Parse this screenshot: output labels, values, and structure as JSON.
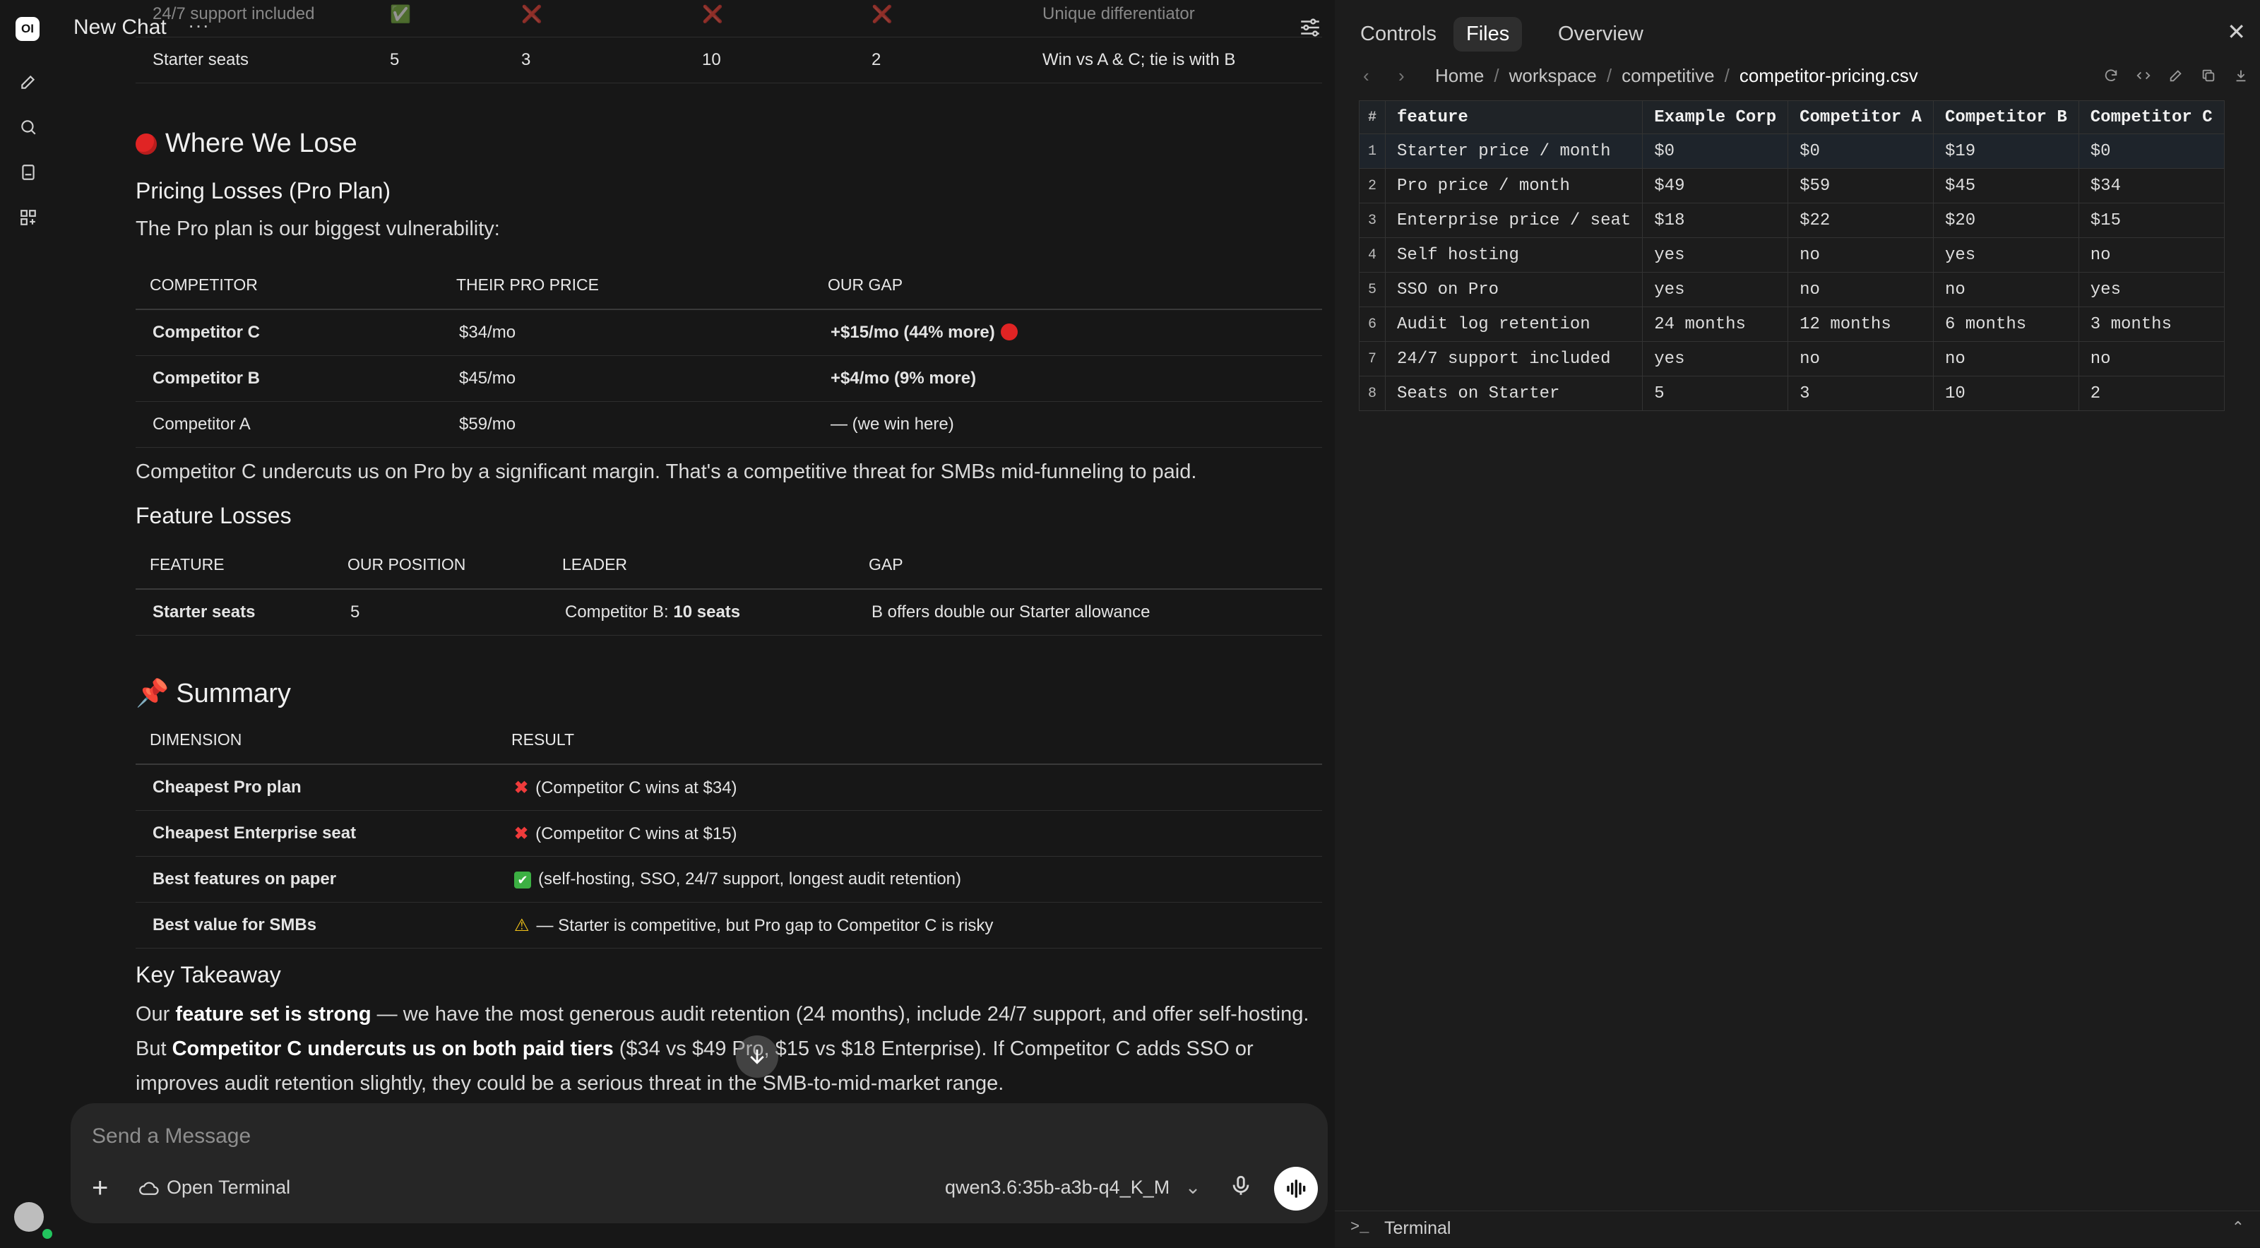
{
  "app": {
    "logo": "OI"
  },
  "chat": {
    "title": "New Chat",
    "more": "···",
    "top_table": {
      "rows": [
        {
          "feature": "24/7 support included",
          "a": "✅",
          "b": "❌",
          "c": "❌",
          "d": "❌",
          "note": "Unique differentiator"
        },
        {
          "feature": "Starter seats",
          "a": "5",
          "b": "3",
          "c": "10",
          "d": "2",
          "note": "Win vs A & C; tie is with B"
        }
      ]
    },
    "where_we_lose": {
      "heading": "Where We Lose",
      "pricing_heading": "Pricing Losses (Pro Plan)",
      "intro": "The Pro plan is our biggest vulnerability:",
      "pricing_table": {
        "headers": [
          "Competitor",
          "Their Pro Price",
          "Our Gap"
        ],
        "rows": [
          {
            "competitor": "Competitor C",
            "price": "$34/mo",
            "gap": "+$15/mo (44% more)"
          },
          {
            "competitor": "Competitor B",
            "price": "$45/mo",
            "gap": "+$4/mo (9% more)"
          },
          {
            "competitor": "Competitor A",
            "price": "$59/mo",
            "gap": "— (we win here)"
          }
        ]
      },
      "pricing_note": "Competitor C undercuts us on Pro by a significant margin. That's a competitive threat for SMBs mid-funneling to paid.",
      "feature_heading": "Feature Losses",
      "feature_table": {
        "headers": [
          "Feature",
          "Our Position",
          "Leader",
          "Gap"
        ],
        "rows": [
          {
            "feature": "Starter seats",
            "position": "5",
            "leader_prefix": "Competitor B: ",
            "leader_bold": "10 seats",
            "gap": "B offers double our Starter allowance"
          }
        ]
      }
    },
    "summary": {
      "heading": "Summary",
      "headers": [
        "Dimension",
        "Result"
      ],
      "rows": [
        {
          "dimension": "Cheapest Pro plan",
          "result": "(Competitor C wins at $34)"
        },
        {
          "dimension": "Cheapest Enterprise seat",
          "result": "(Competitor C wins at $15)"
        },
        {
          "dimension": "Best features on paper",
          "result": "(self-hosting, SSO, 24/7 support, longest audit retention)"
        },
        {
          "dimension": "Best value for SMBs",
          "result": "— Starter is competitive, but Pro gap to Competitor C is risky"
        }
      ]
    },
    "takeaway": {
      "heading": "Key Takeaway",
      "t1": "Our ",
      "t2": "feature set is strong",
      "t3": " — we have the most generous audit retention (24 months), include 24/7 support, and offer self-hosting. But ",
      "t4": "Competitor C undercuts us on both paid tiers",
      "t5": " ($34 vs $49 Pro, $15 vs $18 Enterprise). If Competitor C adds SSO or improves audit retention slightly, they could be a serious threat in the SMB-to-mid-market range."
    },
    "input": {
      "placeholder": "Send a Message",
      "open_terminal": "Open Terminal",
      "model": "qwen3.6:35b-a3b-q4_K_M"
    }
  },
  "panel": {
    "tabs": [
      "Controls",
      "Files",
      "Overview"
    ],
    "active_tab": "Files",
    "breadcrumb": [
      "Home",
      "workspace",
      "competitive",
      "competitor-pricing.csv"
    ],
    "csv": {
      "headers": [
        "#",
        "feature",
        "Example Corp",
        "Competitor A",
        "Competitor B",
        "Competitor C"
      ],
      "rows": [
        [
          "1",
          "Starter price / month",
          "$0",
          "$0",
          "$19",
          "$0"
        ],
        [
          "2",
          "Pro price / month",
          "$49",
          "$59",
          "$45",
          "$34"
        ],
        [
          "3",
          "Enterprise price / seat",
          "$18",
          "$22",
          "$20",
          "$15"
        ],
        [
          "4",
          "Self hosting",
          "yes",
          "no",
          "yes",
          "no"
        ],
        [
          "5",
          "SSO on Pro",
          "yes",
          "no",
          "no",
          "yes"
        ],
        [
          "6",
          "Audit log retention",
          "24 months",
          "12 months",
          "6 months",
          "3 months"
        ],
        [
          "7",
          "24/7 support included",
          "yes",
          "no",
          "no",
          "no"
        ],
        [
          "8",
          "Seats on Starter",
          "5",
          "3",
          "10",
          "2"
        ]
      ]
    },
    "terminal_label": "Terminal"
  }
}
